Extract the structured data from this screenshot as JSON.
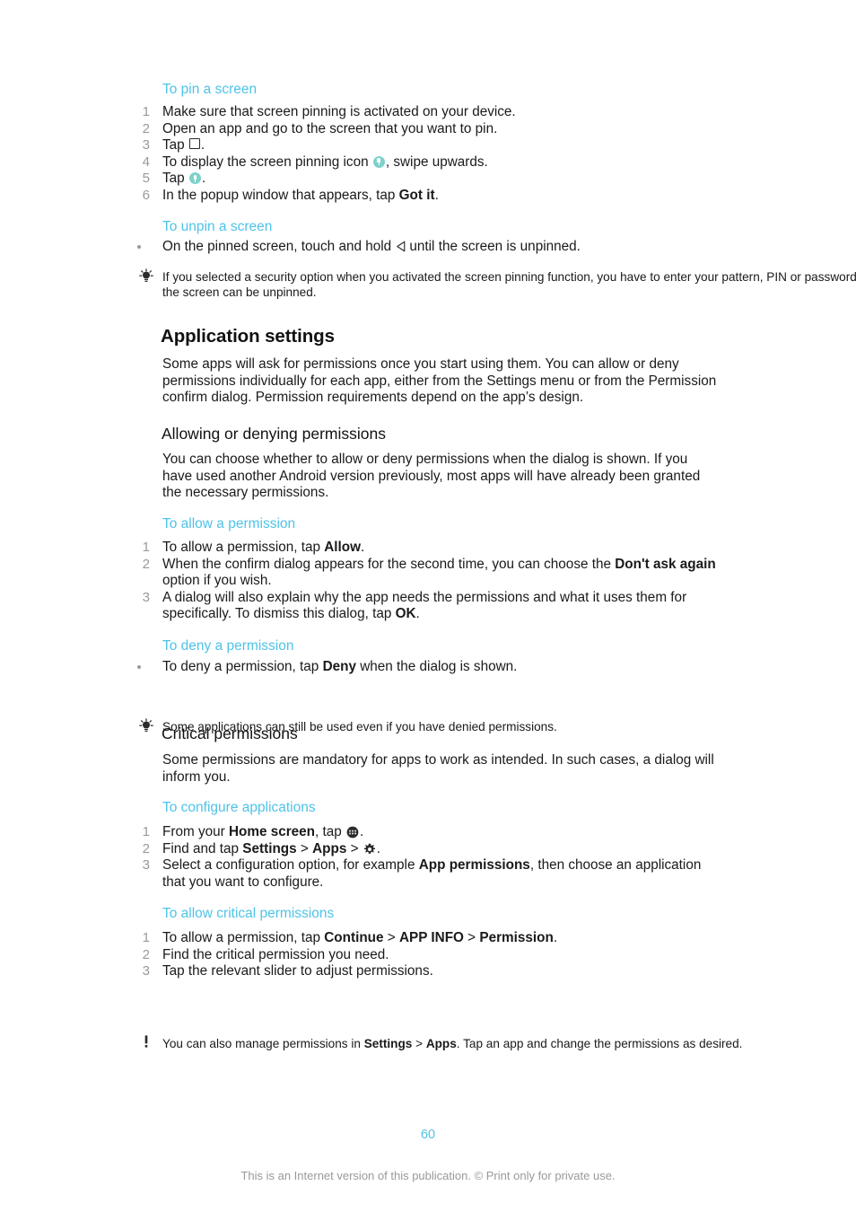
{
  "document": {
    "page_number": "60",
    "footer_note": "This is an Internet version of this publication. © Print only for private use."
  },
  "sections": {
    "pin_screen": {
      "heading": "To pin a screen",
      "steps": [
        {
          "num": "1",
          "text": "Make sure that screen pinning is activated on your device."
        },
        {
          "num": "2",
          "text": "Open an app and go to the screen that you want to pin."
        },
        {
          "num": "3",
          "pre": "Tap ",
          "icon": "recents-square-icon",
          "post": "."
        },
        {
          "num": "4",
          "pre": "To display the screen pinning icon ",
          "icon": "screen-pin-icon",
          "post": ", swipe upwards."
        },
        {
          "num": "5",
          "pre": "Tap ",
          "icon": "screen-pin-icon",
          "post": "."
        },
        {
          "num": "6",
          "pre": "In the popup window that appears, tap ",
          "bold": "Got it",
          "post": "."
        }
      ]
    },
    "unpin_screen": {
      "heading": "To unpin a screen",
      "bullet": {
        "pre": "On the pinned screen, touch and hold ",
        "icon": "back-arrow-icon",
        "post": "until the screen is unpinned."
      },
      "tip": "If you selected a security option when you activated the screen pinning function, you have to enter your pattern, PIN or password to unlock the device before the screen can be unpinned."
    },
    "application_settings": {
      "heading": "Application settings",
      "intro": "Some apps will ask for permissions once you start using them. You can allow or deny permissions individually for each app, either from the Settings menu or from the Permission confirm dialog. Permission requirements depend on the app’s design."
    },
    "allowing_denying": {
      "heading": "Allowing or denying permissions",
      "intro": "You can choose whether to allow or deny permissions when the dialog is shown. If you have used another Android version previously, most apps will have already been granted the necessary permissions."
    },
    "allow_permission": {
      "heading": "To allow a permission",
      "steps": [
        {
          "num": "1",
          "pre": "To allow a permission, tap ",
          "bold": "Allow",
          "post": "."
        },
        {
          "num": "2",
          "pre": "When the confirm dialog appears for the second time, you can choose the ",
          "bold": "Don't ask again",
          "post": " option if you wish."
        },
        {
          "num": "3",
          "pre": "A dialog will also explain why the app needs the permissions and what it uses them for specifically. To dismiss this dialog, tap ",
          "bold": "OK",
          "post": "."
        }
      ]
    },
    "deny_permission": {
      "heading": "To deny a permission",
      "bullet": {
        "pre": "To deny a permission, tap ",
        "bold": "Deny",
        "post": " when the dialog is shown."
      },
      "tip": "Some applications can still be used even if you have denied permissions."
    },
    "critical_permissions": {
      "heading": "Critical permissions",
      "intro": "Some permissions are mandatory for apps to work as intended. In such cases, a dialog will inform you."
    },
    "configure_applications": {
      "heading": "To configure applications",
      "steps": [
        {
          "num": "1",
          "pre": "From your ",
          "bold": "Home screen",
          "mid": ", tap ",
          "icon": "app-drawer-icon",
          "post": "."
        },
        {
          "num": "2",
          "pre": "Find and tap ",
          "bold": "Settings",
          "sep1": " > ",
          "bold2": "Apps",
          "sep2": " > ",
          "icon": "gear-icon",
          "post": "."
        },
        {
          "num": "3",
          "pre": "Select a configuration option, for example ",
          "bold": "App permissions",
          "post": ", then choose an application that you want to configure."
        }
      ]
    },
    "allow_critical_permissions": {
      "heading": "To allow critical permissions",
      "steps": [
        {
          "num": "1",
          "pre": "To allow a permission, tap ",
          "bold": "Continue",
          "sep1": " > ",
          "bold2": "APP INFO",
          "sep2": " > ",
          "bold3": "Permission",
          "post": "."
        },
        {
          "num": "2",
          "text": "Find the critical permission you need."
        },
        {
          "num": "3",
          "text": "Tap the relevant slider to adjust permissions."
        }
      ],
      "note": {
        "pre": "You can also manage permissions in ",
        "bold": "Settings",
        "sep1": " > ",
        "bold2": "Apps",
        "post": ". Tap an app and change the permissions as desired."
      }
    }
  },
  "colors": {
    "accent_cyan": "#4ec3e8",
    "pin_icon_teal": "#7fd1cb",
    "muted_gray": "#9a9a9a",
    "footer_gray": "#999999"
  }
}
